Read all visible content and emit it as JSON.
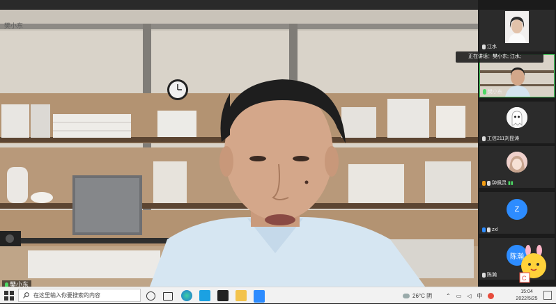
{
  "main": {
    "title": "樊小东",
    "speaker_name": "樊小东",
    "speaking_notice": "正在讲话：樊小东; 江水;"
  },
  "sidebar": {
    "tiles": [
      {
        "name": "江水"
      },
      {
        "name": "樊小东"
      },
      {
        "name": "工信211刘昆涛"
      },
      {
        "name": "钟佩灵"
      },
      {
        "name": "zxl",
        "avatar_letter": "Z"
      },
      {
        "name": "陈瀚",
        "avatar_letter": "陈瀚"
      }
    ]
  },
  "taskbar": {
    "search_placeholder": "在这里输入你要搜索的内容",
    "weather": "26°C 阴",
    "ime": "中",
    "time": "15:04",
    "date": "2022/5/25"
  },
  "colors": {
    "accent": "#2d8cff",
    "mic_active": "#4cd964",
    "speaking_border": "#4cd964"
  }
}
